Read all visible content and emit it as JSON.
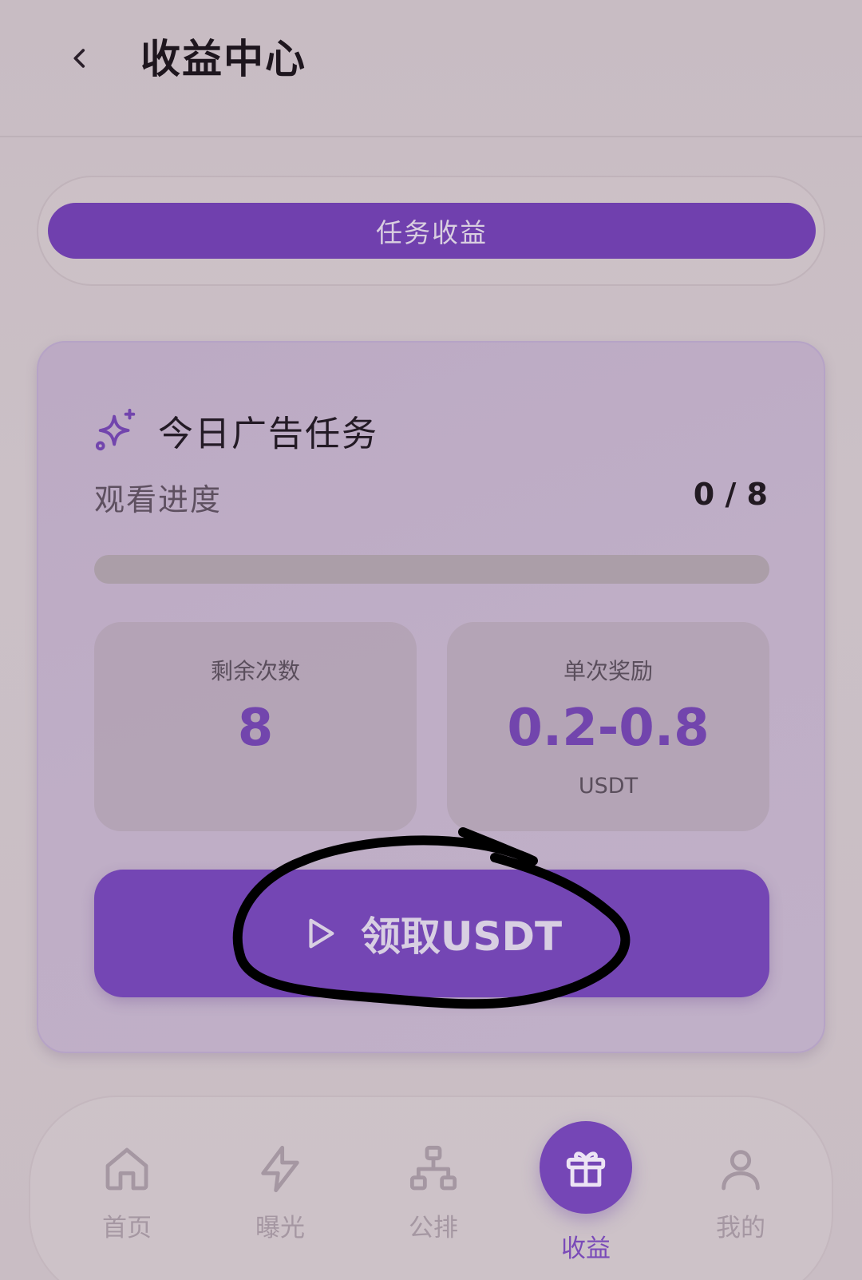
{
  "header": {
    "title": "收益中心",
    "back_icon": "chevron-left-icon"
  },
  "tabs": [
    {
      "label": "任务收益",
      "active": true
    }
  ],
  "task_card": {
    "icon": "sparkle-icon",
    "title": "今日广告任务",
    "progress_label": "观看进度",
    "progress_count": "0 / 8",
    "progress_fraction": 0,
    "remaining": {
      "label": "剩余次数",
      "value": "8"
    },
    "reward": {
      "label": "单次奖励",
      "value": "0.2-0.8",
      "unit": "USDT"
    },
    "claim_button": {
      "icon": "play-icon",
      "label": "领取USDT"
    }
  },
  "bottom_nav": {
    "items": [
      {
        "label": "首页",
        "icon": "home-icon"
      },
      {
        "label": "曝光",
        "icon": "lightning-icon"
      },
      {
        "label": "公排",
        "icon": "network-icon"
      },
      {
        "label": "收益",
        "icon": "gift-icon",
        "active": true
      },
      {
        "label": "我的",
        "icon": "user-icon"
      }
    ]
  },
  "colors": {
    "accent": "#7446b4",
    "background": "#cbbfc6",
    "card": "#bfaec6"
  }
}
